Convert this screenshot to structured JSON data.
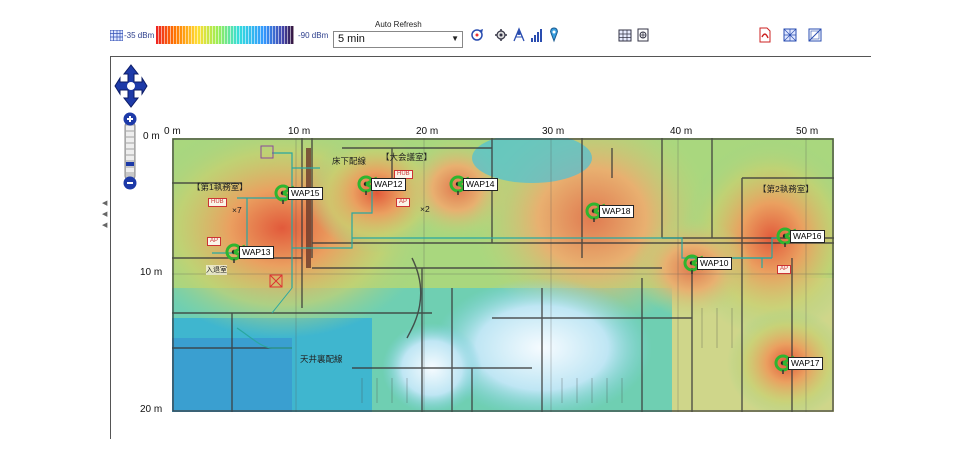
{
  "toolbar": {
    "legend_min_label": "-35 dBm",
    "legend_max_label": "-90 dBm",
    "auto_refresh_label": "Auto Refresh",
    "auto_refresh_value": "5 min",
    "icons": [
      "refresh-ap-icon",
      "ap-settings-icon",
      "ap-scan-icon",
      "signal-bars-icon",
      "probe-icon",
      "grid-settings-icon",
      "export-icon",
      "pdf-icon",
      "heatmap-icon",
      "floor-image-icon"
    ]
  },
  "map": {
    "x_ticks": [
      "0 m",
      "10 m",
      "20 m",
      "30 m",
      "40 m",
      "50 m"
    ],
    "y_ticks": [
      "0 m",
      "10 m",
      "20 m"
    ],
    "rooms": {
      "room1": "【第1執務室】",
      "room2": "【大会議室】",
      "room3": "【第2執務室】"
    },
    "annotations": {
      "floor_wiring": "床下配線",
      "ceiling_wiring": "天井裏配線",
      "entrance": "入退室",
      "x7": "×7",
      "x2": "×2",
      "hub": "HUB",
      "ap": "AP"
    },
    "waps": [
      {
        "name": "WAP15"
      },
      {
        "name": "WAP12"
      },
      {
        "name": "WAP14"
      },
      {
        "name": "WAP18"
      },
      {
        "name": "WAP13"
      },
      {
        "name": "WAP10"
      },
      {
        "name": "WAP16"
      },
      {
        "name": "WAP17"
      }
    ]
  },
  "colors": {
    "wap_marker": "#2fb52f",
    "wiring": "#2aa7a0",
    "toolbar_text": "#2c3e8c"
  }
}
